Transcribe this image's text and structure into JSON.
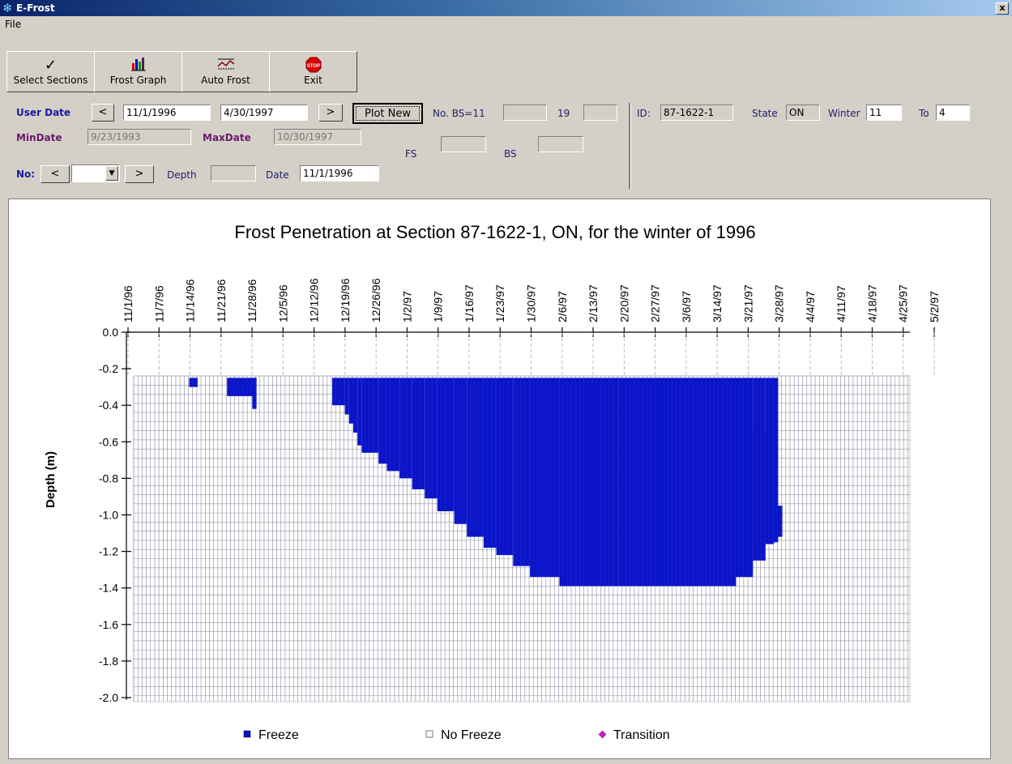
{
  "window": {
    "title": "E-Frost",
    "close_label": "x"
  },
  "menu": {
    "file": "File"
  },
  "toolbar": {
    "select_sections": "Select Sections",
    "frost_graph": "Frost Graph",
    "auto_frost": "Auto Frost",
    "exit": "Exit"
  },
  "controls": {
    "user_date_label": "User Date",
    "prev": "<",
    "next": ">",
    "user_date_from": "11/1/1996",
    "user_date_to": "4/30/1997",
    "plot_new": "Plot New",
    "no_bs_label": "No. BS=11",
    "no_bs_value": "",
    "nineteen_label": "19",
    "nineteen_value": "",
    "id_label": "ID:",
    "id_value": "87-1622-1",
    "state_label": "State",
    "state_value": "ON",
    "winter_label": "Winter",
    "winter_value": "11",
    "to_label": "To",
    "to_value": "4",
    "min_date_label": "MinDate",
    "min_date_value": "9/23/1993",
    "max_date_label": "MaxDate",
    "max_date_value": "10/30/1997",
    "fs_label": "FS",
    "fs_value": "",
    "bs_label": "BS",
    "bs_value": "",
    "no_label": "No:",
    "no_value": "",
    "depth_label": "Depth",
    "depth_value": "",
    "date_label": "Date",
    "date_value": "11/1/1996"
  },
  "chart_data": {
    "type": "heatmap",
    "title": "Frost Penetration at Section 87-1622-1, ON, for the winter of 1996",
    "ylabel": "Depth (m)",
    "xlabel": "",
    "x_ticks": [
      "11/1/96",
      "11/7/96",
      "11/14/96",
      "11/21/96",
      "11/28/96",
      "12/5/96",
      "12/12/96",
      "12/19/96",
      "12/26/96",
      "1/2/97",
      "1/9/97",
      "1/16/97",
      "1/23/97",
      "1/30/97",
      "2/6/97",
      "2/13/97",
      "2/20/97",
      "2/27/97",
      "3/6/97",
      "3/14/97",
      "3/21/97",
      "3/28/97",
      "4/4/97",
      "4/11/97",
      "4/18/97",
      "4/25/97",
      "5/2/97"
    ],
    "y_ticks": [
      "0.0",
      "-0.2",
      "-0.4",
      "-0.6",
      "-0.8",
      "-1.0",
      "-1.2",
      "-1.4",
      "-1.6",
      "-1.8",
      "-2.0"
    ],
    "ylim": [
      -2.0,
      0.0
    ],
    "legend": [
      {
        "name": "Freeze",
        "color": "#0a14c8"
      },
      {
        "name": "No Freeze",
        "color": "#ffffff"
      },
      {
        "name": "Transition",
        "color": "#c020c0"
      }
    ],
    "legend_placement": "bottom",
    "grid": true,
    "freeze_extent_days_since_nov1": [
      {
        "from": 13,
        "to": 15,
        "bottom_depth": -0.3
      },
      {
        "from": 22,
        "to": 29,
        "bottom_depth": -0.35
      },
      {
        "from": 28,
        "to": 29,
        "bottom_depth": -0.42
      },
      {
        "from": 31,
        "to": 35,
        "bottom_depth": -0.25
      },
      {
        "from": 47,
        "to": 50,
        "bottom_depth": -0.4
      },
      {
        "from": 50,
        "to": 51,
        "bottom_depth": -0.45
      },
      {
        "from": 51,
        "to": 52,
        "bottom_depth": -0.5
      },
      {
        "from": 52,
        "to": 53,
        "bottom_depth": -0.55
      },
      {
        "from": 53,
        "to": 54,
        "bottom_depth": -0.62
      },
      {
        "from": 54,
        "to": 58,
        "bottom_depth": -0.66
      },
      {
        "from": 58,
        "to": 60,
        "bottom_depth": -0.72
      },
      {
        "from": 60,
        "to": 63,
        "bottom_depth": -0.76
      },
      {
        "from": 63,
        "to": 66,
        "bottom_depth": -0.8
      },
      {
        "from": 66,
        "to": 69,
        "bottom_depth": -0.86
      },
      {
        "from": 69,
        "to": 72,
        "bottom_depth": -0.91
      },
      {
        "from": 72,
        "to": 76,
        "bottom_depth": -0.98
      },
      {
        "from": 76,
        "to": 79,
        "bottom_depth": -1.05
      },
      {
        "from": 79,
        "to": 83,
        "bottom_depth": -1.12
      },
      {
        "from": 83,
        "to": 86,
        "bottom_depth": -1.18
      },
      {
        "from": 86,
        "to": 90,
        "bottom_depth": -1.22
      },
      {
        "from": 90,
        "to": 94,
        "bottom_depth": -1.28
      },
      {
        "from": 94,
        "to": 101,
        "bottom_depth": -1.34
      },
      {
        "from": 101,
        "to": 115,
        "bottom_depth": -1.39
      },
      {
        "from": 115,
        "to": 143,
        "bottom_depth": -1.39
      },
      {
        "from": 143,
        "to": 147,
        "bottom_depth": -1.34
      },
      {
        "from": 147,
        "to": 150,
        "bottom_depth": -1.25
      },
      {
        "from": 150,
        "to": 153,
        "bottom_depth": -1.15
      }
    ],
    "freeze_top_depth": -0.25,
    "freeze_top_start_day": 47,
    "freeze_top_end_day": 148
  }
}
